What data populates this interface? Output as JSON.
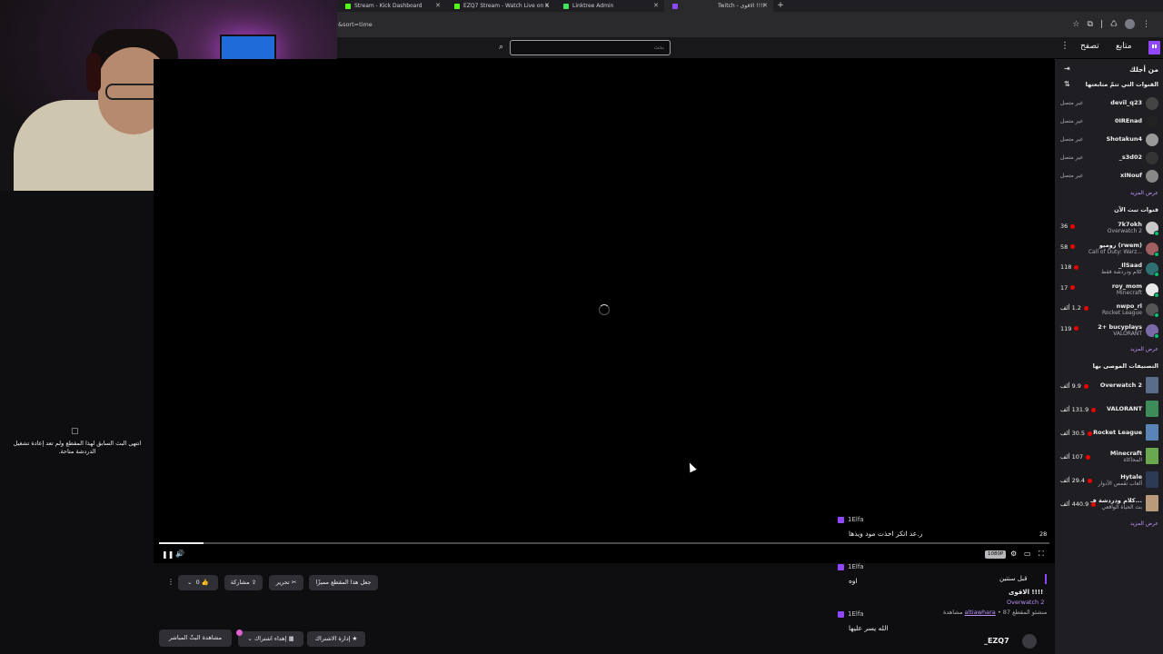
{
  "browser": {
    "tabs": [
      {
        "label": "Stream - Kick Dashboard",
        "color": "#53fc18"
      },
      {
        "label": "EZQ7 Stream - Watch Live on K",
        "color": "#53fc18"
      },
      {
        "label": "Linktree Admin",
        "color": "#43e55e"
      },
      {
        "label": "Twitch - الاقوى !!!!",
        "color": "#9147ff"
      }
    ],
    "new_tab": "+",
    "url": "&sort=time"
  },
  "topnav": {
    "search_placeholder": "بحث",
    "browse": "تصفح",
    "following": "متابع",
    "more": "⋮"
  },
  "player": {
    "elapsed": "28",
    "quality": "1080P",
    "progress": 0.05
  },
  "chat_replay": [
    {
      "user": "1Elfa",
      "text": "ر.عد اتكر اخذت مود ويذها"
    },
    {
      "user": "1Elfa",
      "text": "اوه"
    },
    {
      "user": "1Elfa",
      "text": "الله يسر عليها"
    }
  ],
  "below": {
    "watch_live": "مشاهدة البثّ المباشر",
    "gift_sub": "إهداء اشتراك",
    "manage_sub": "إدارة الاشتراك",
    "feature_clip": "جعل هذا المقطع مميزًا",
    "edit": "تحرير",
    "share": "مشاركة",
    "likes": "0",
    "ago": "قبل سنتين",
    "title": "الاقوى !!!!",
    "game": "Overwatch 2",
    "views": "87 مشاهدة",
    "clipper_label": "منشئو المقطع",
    "clipper": "altiawhara",
    "channel": "_EZQ7"
  },
  "chat_ended": {
    "text": "انتهى البث السابق لهذا المقطع ولم تعد إعادة تشغيل الدردشة متاحة."
  },
  "sidebar": {
    "for_you": "من أجلك",
    "followed_header": "القنوات التي تتمّ متابعتها",
    "offline_label": "غير متصل",
    "followed": [
      {
        "name": "devil_q23",
        "avatar": "#444"
      },
      {
        "name": "0IREnad",
        "avatar": "#222"
      },
      {
        "name": "Shotakun4",
        "avatar": "#999"
      },
      {
        "name": "_s3d02",
        "avatar": "#333"
      },
      {
        "name": "xINouf",
        "avatar": "#888"
      }
    ],
    "show_more": "عرض المزيد",
    "live_header": "قنوات تبث الآن",
    "live": [
      {
        "name": "7k7okh",
        "game": "Overwatch 2",
        "viewers": "36",
        "avatar": "#c9c9c9"
      },
      {
        "name": "روميو (rwem)",
        "game": "Call of Duty: Warz...",
        "viewers": "58",
        "avatar": "#a06060"
      },
      {
        "name": "_IlSaad",
        "game": "كلام ودردشة فقط",
        "viewers": "118",
        "avatar": "#2f7070"
      },
      {
        "name": "roy_mom",
        "game": "Minecraft",
        "viewers": "17",
        "avatar": "#e8e8e8"
      },
      {
        "name": "nwpo_rl",
        "game": "Rocket League",
        "viewers": "1.2 ألف",
        "avatar": "#555"
      },
      {
        "name": "2+ bucyplays",
        "game": "VALORANT",
        "viewers": "119",
        "avatar": "#7a6aa8"
      }
    ],
    "categories_header": "التصنيفات الموصى بها",
    "categories": [
      {
        "name": "Overwatch 2",
        "sub": "",
        "viewers": "9.9 ألف",
        "color": "#5a6c8a"
      },
      {
        "name": "VALORANT",
        "sub": "",
        "viewers": "131.9 ألف",
        "color": "#3d8c5a"
      },
      {
        "name": "Rocket League",
        "sub": "",
        "viewers": "30.5 ألف",
        "color": "#5a84b8"
      },
      {
        "name": "Minecraft",
        "sub": "المحاكاة",
        "viewers": "107 ألف",
        "color": "#6aa84f"
      },
      {
        "name": "Hytale",
        "sub": "ألعاب تقمص الأدوار",
        "viewers": "29.4 ألف",
        "color": "#2d3a55"
      },
      {
        "name": "كلام ودردشة فـ...",
        "sub": "بث الحياة الواقعي",
        "viewers": "440.9 ألف",
        "color": "#b99a7a"
      }
    ]
  }
}
